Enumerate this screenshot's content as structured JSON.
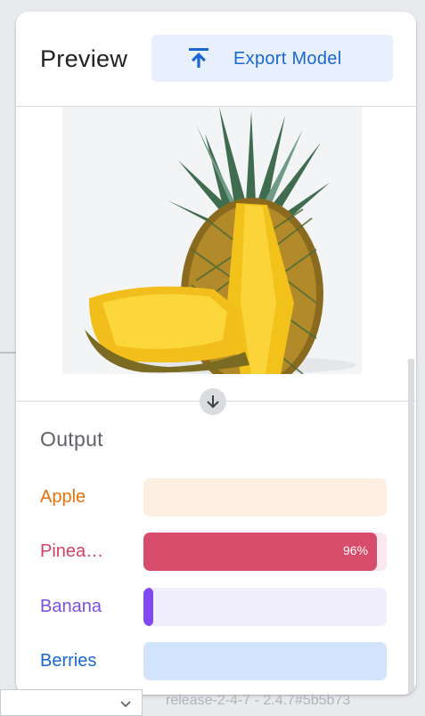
{
  "header": {
    "title": "Preview",
    "export_label": "Export Model",
    "export_icon": "upload-icon"
  },
  "preview_image": {
    "subject": "pineapple"
  },
  "output": {
    "title": "Output",
    "classes": [
      {
        "label": "Apple",
        "label_color": "#e8710a",
        "track_color": "#feefe3",
        "fill_color": "#e8710a",
        "value": 0,
        "percent_text": ""
      },
      {
        "label": "Pinea…",
        "label_color": "#d33f61",
        "track_color": "#fce8ec",
        "fill_color": "#d74b6b",
        "value": 0.96,
        "percent_text": "96%"
      },
      {
        "label": "Banana",
        "label_color": "#7b4fe0",
        "track_color": "#f0eefc",
        "fill_color": "#8149f1",
        "value": 0.04,
        "percent_text": ""
      },
      {
        "label": "Berries",
        "label_color": "#1967d2",
        "track_color": "#d2e3fc",
        "fill_color": "#1967d2",
        "value": 0,
        "percent_text": ""
      }
    ]
  },
  "footer": {
    "release_text": "release-2-4-7 - 2.4.7#5b5b73"
  }
}
